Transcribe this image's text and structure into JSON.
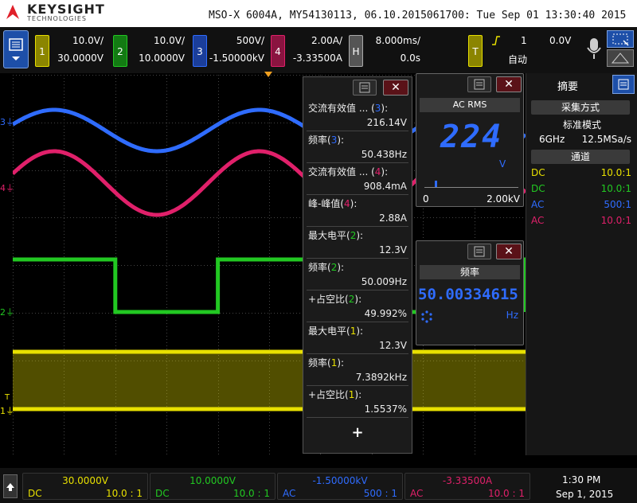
{
  "header": {
    "brand": "KEYSIGHT",
    "brand_sub": "TECHNOLOGIES",
    "title": "MSO-X 6004A, MY54130113, 06.10.2015061700: Tue Sep 01 13:30:40 2015"
  },
  "channels": [
    {
      "id": "1",
      "scale": "10.0V/",
      "offset": "30.0000V",
      "color": "#e8e000"
    },
    {
      "id": "2",
      "scale": "10.0V/",
      "offset": "10.0000V",
      "color": "#22c822"
    },
    {
      "id": "3",
      "scale": "500V/",
      "offset": "-1.50000kV",
      "color": "#2f6cff"
    },
    {
      "id": "4",
      "scale": "2.00A/",
      "offset": "-3.33500A",
      "color": "#e0206a"
    }
  ],
  "horizontal": {
    "tag": "H",
    "scale": "8.000ms/",
    "delay": "0.0s"
  },
  "trigger": {
    "tag": "T",
    "source": "1",
    "level": "0.0V",
    "mode": "自动",
    "slope_icon": "rising-edge-icon"
  },
  "measurements": [
    {
      "label": "交流有效值 ... (",
      "ch": "3",
      "suffix": "):",
      "value": "216.14V",
      "color": "#2f6cff"
    },
    {
      "label": "频率(",
      "ch": "3",
      "suffix": "):",
      "value": "50.438Hz",
      "color": "#2f6cff"
    },
    {
      "label": "交流有效值 ... (",
      "ch": "4",
      "suffix": "):",
      "value": "908.4mA",
      "color": "#e0206a"
    },
    {
      "label": "峰-峰值(",
      "ch": "4",
      "suffix": "):",
      "value": "2.88A",
      "color": "#e0206a"
    },
    {
      "label": "最大电平(",
      "ch": "2",
      "suffix": "):",
      "value": "12.3V",
      "color": "#22c822"
    },
    {
      "label": "频率(",
      "ch": "2",
      "suffix": "):",
      "value": "50.009Hz",
      "color": "#22c822"
    },
    {
      "label": "+占空比(",
      "ch": "2",
      "suffix": "):",
      "value": "49.992%",
      "color": "#22c822"
    },
    {
      "label": "最大电平(",
      "ch": "1",
      "suffix": "):",
      "value": "12.3V",
      "color": "#e8e000"
    },
    {
      "label": "频率(",
      "ch": "1",
      "suffix": "):",
      "value": "7.3892kHz",
      "color": "#e8e000"
    },
    {
      "label": "+占空比(",
      "ch": "1",
      "suffix": "):",
      "value": "1.5537%",
      "color": "#e8e000"
    }
  ],
  "add_label": "+",
  "dvm": {
    "mode": "AC RMS",
    "reading": "224",
    "unit": "V",
    "scale_min": "0",
    "scale_max": "2.00kV",
    "level": 0.11
  },
  "counter": {
    "title": "频率",
    "reading": "50.00334615",
    "unit": "Hz"
  },
  "side": {
    "title": "摘要",
    "acq_head": "采集方式",
    "acq_mode": "标准模式",
    "rate_l": "6GHz",
    "rate_r": "12.5MSa/s",
    "ch_head": "通道",
    "rows": [
      {
        "coupling": "DC",
        "probe": "10.0:1",
        "color": "#e8e000"
      },
      {
        "coupling": "DC",
        "probe": "10.0:1",
        "color": "#22c822"
      },
      {
        "coupling": "AC",
        "probe": "500:1",
        "color": "#2f6cff"
      },
      {
        "coupling": "AC",
        "probe": "10.0:1",
        "color": "#e0206a"
      }
    ]
  },
  "bottom": [
    {
      "offset": "30.0000V",
      "coupling": "DC",
      "probe": "10.0 : 1",
      "color": "#e8e000"
    },
    {
      "offset": "10.0000V",
      "coupling": "DC",
      "probe": "10.0 : 1",
      "color": "#22c822"
    },
    {
      "offset": "-1.50000kV",
      "coupling": "AC",
      "probe": "500 : 1",
      "color": "#2f6cff"
    },
    {
      "offset": "-3.33500A",
      "coupling": "AC",
      "probe": "10.0 : 1",
      "color": "#e0206a"
    }
  ],
  "clock": {
    "time": "1:30 PM",
    "date": "Sep 1, 2015"
  },
  "markers": {
    "ch1": "1",
    "ch2": "2",
    "ch3": "3",
    "ch4": "4",
    "trig": "T"
  }
}
